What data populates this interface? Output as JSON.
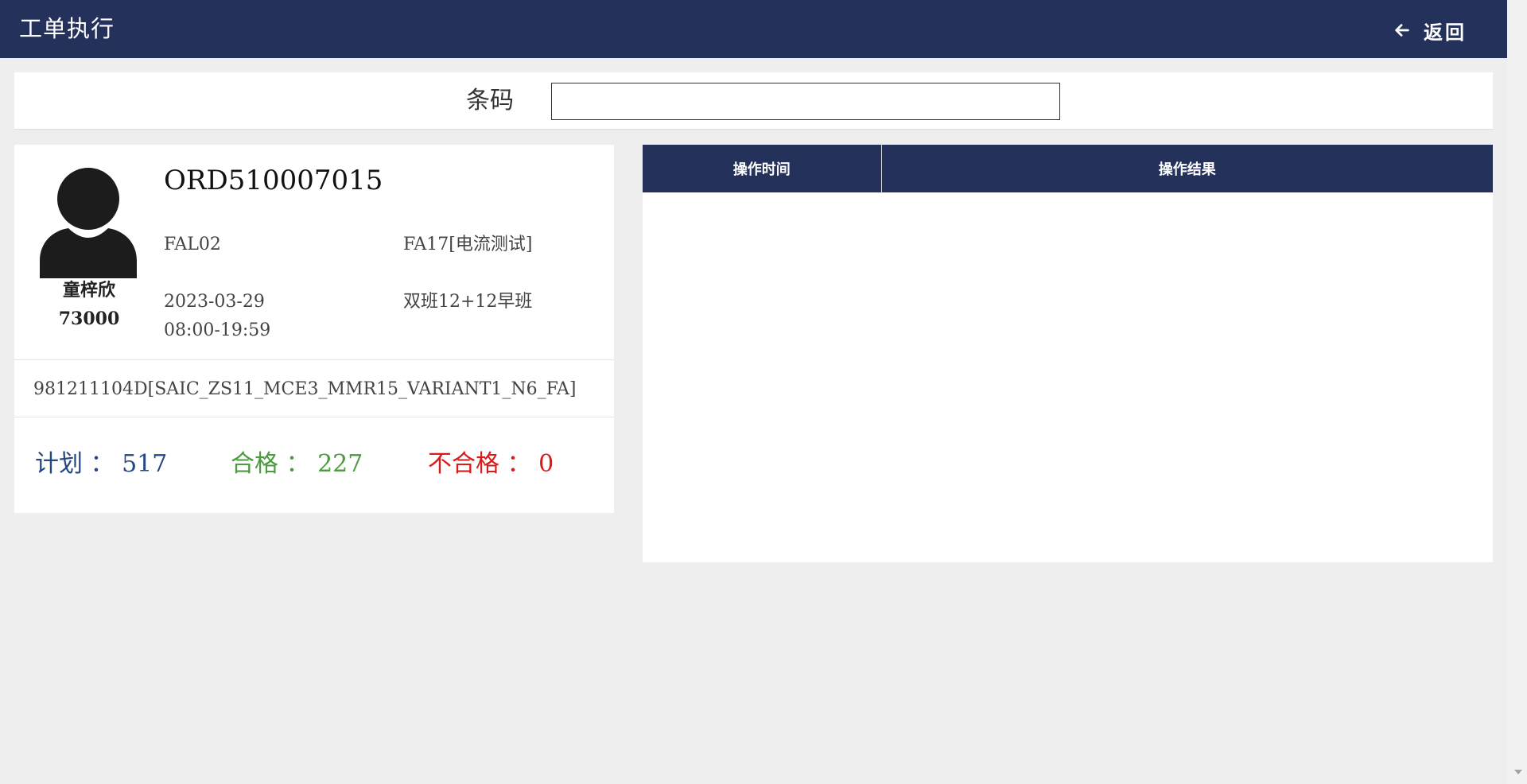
{
  "header": {
    "title": "工单执行",
    "back_label": "返回"
  },
  "barcode": {
    "label": "条码",
    "value": ""
  },
  "operator": {
    "name": "童梓欣",
    "id": "73000"
  },
  "order": {
    "number": "ORD510007015",
    "line": "FAL02",
    "station": "FA17[电流测试]",
    "date": "2023-03-29",
    "time_range": "08:00-19:59",
    "shift": "双班12+12早班",
    "product": "981211104D[SAIC_ZS11_MCE3_MMR15_VARIANT1_N6_FA]"
  },
  "stats": {
    "plan_text": "计划 ： 517",
    "pass_text": "合格 ： 227",
    "fail_text": "不合格 ： 0",
    "plan_color": "#24477f",
    "pass_color": "#4c9a3f",
    "fail_color": "#d71a1a"
  },
  "log_table": {
    "columns": [
      "操作时间",
      "操作结果"
    ],
    "rows": []
  },
  "colors": {
    "header_bg": "#24315a",
    "page_bg": "#eeeeee"
  },
  "icons": {
    "back": "arrow-left-icon",
    "avatar": "user-avatar-icon"
  }
}
